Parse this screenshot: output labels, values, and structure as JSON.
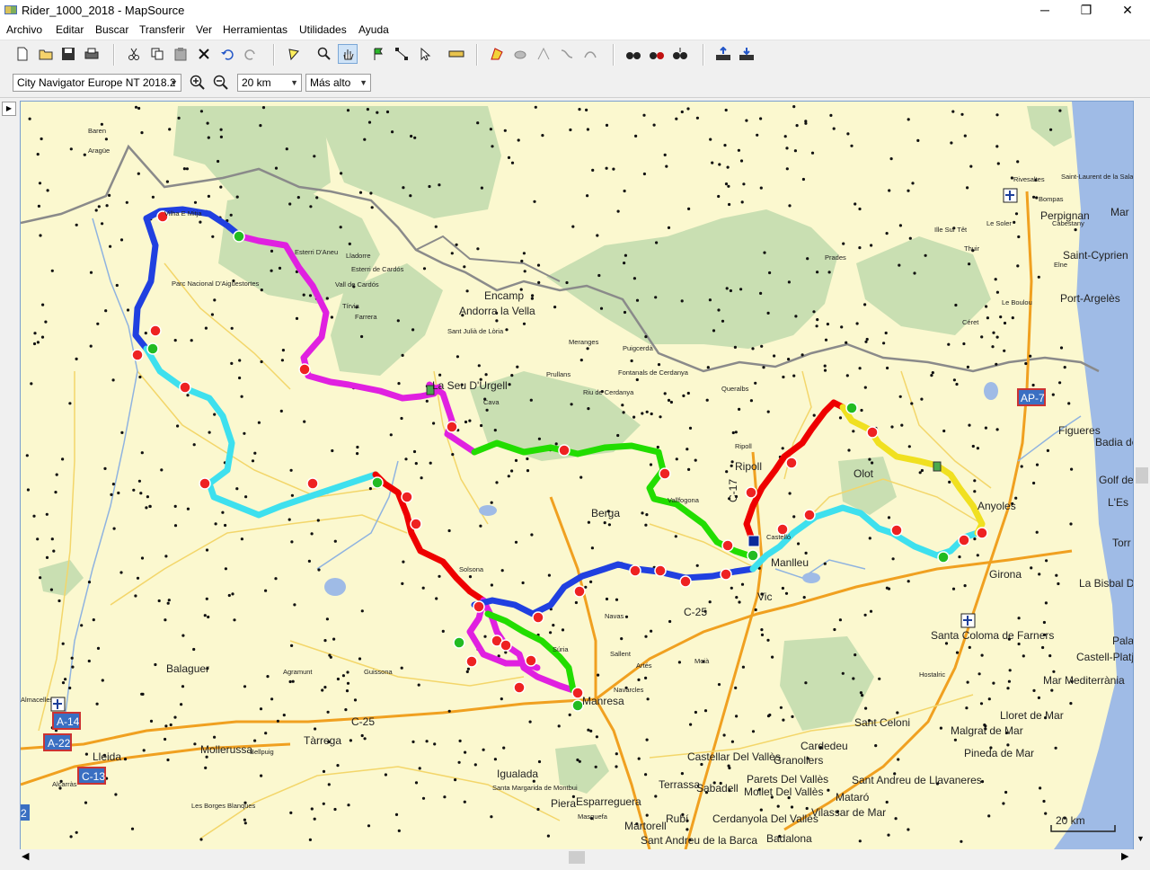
{
  "window": {
    "title": "Rider_1000_2018 - MapSource",
    "minimize": "─",
    "maximize": "❐",
    "close": "✕"
  },
  "menu": [
    "Archivo",
    "Editar",
    "Buscar",
    "Transferir",
    "Ver",
    "Herramientas",
    "Utilidades",
    "Ayuda"
  ],
  "toolbar": {
    "icons": [
      "new-file-icon",
      "open-folder-icon",
      "save-icon",
      "print-icon",
      "cut-icon",
      "copy-icon",
      "paste-icon",
      "delete-icon",
      "undo-icon",
      "redo-icon",
      "select-icon",
      "zoom-tool-icon",
      "pan-hand-icon",
      "waypoint-flag-icon",
      "route-tool-icon",
      "pointer-icon",
      "measure-icon",
      "track-edit-icon",
      "eraser-icon",
      "track-join-icon",
      "track-divide-icon",
      "track-filter-icon",
      "find-binoculars-icon",
      "find-address-icon",
      "find-nearest-icon",
      "receive-from-device-icon",
      "send-to-device-icon"
    ]
  },
  "map_controls": {
    "map_product": "City Navigator Europe NT 2018.2",
    "zoom_level": "20 km",
    "detail_level": "Más alto",
    "zoom_in_icon": "zoom-in-icon",
    "zoom_out_icon": "zoom-out-icon"
  },
  "map": {
    "scale_label": "20 km",
    "places_large": [
      {
        "name": "Encamp"
      },
      {
        "name": "Andorra la Vella"
      },
      {
        "name": "La Seu D'Urgell"
      },
      {
        "name": "Perpignan"
      },
      {
        "name": "Saint-Cyprien"
      },
      {
        "name": "Port-Argelès"
      },
      {
        "name": "Berga"
      },
      {
        "name": "Ripoll"
      },
      {
        "name": "Olot"
      },
      {
        "name": "Manlleu"
      },
      {
        "name": "Vic"
      },
      {
        "name": "Girona"
      },
      {
        "name": "Figueres"
      },
      {
        "name": "Manresa"
      },
      {
        "name": "Balaguer"
      },
      {
        "name": "Tàrrega"
      },
      {
        "name": "Lleida"
      },
      {
        "name": "Igualada"
      },
      {
        "name": "Terrassa"
      },
      {
        "name": "Sabadell"
      },
      {
        "name": "Mataró"
      },
      {
        "name": "Granollers"
      },
      {
        "name": "Badalona"
      },
      {
        "name": "Rubí"
      },
      {
        "name": "Martorell"
      },
      {
        "name": "Cardedeu"
      },
      {
        "name": "Santa Coloma de Farners"
      },
      {
        "name": "Sant Celoni"
      },
      {
        "name": "Lloret de Mar"
      },
      {
        "name": "Malgrat de Mar"
      },
      {
        "name": "Pineda de Mar"
      },
      {
        "name": "Mar Mediterrània"
      },
      {
        "name": "Castell-Platja"
      },
      {
        "name": "La Bisbal D'E"
      },
      {
        "name": "Badia de"
      },
      {
        "name": "Golf de"
      },
      {
        "name": "L'Es"
      },
      {
        "name": "Torr"
      },
      {
        "name": "Pala"
      },
      {
        "name": "Mollerussa"
      },
      {
        "name": "Esparreguera"
      },
      {
        "name": "Piera"
      },
      {
        "name": "Castellar Del Vallès"
      },
      {
        "name": "Parets Del Vallès"
      },
      {
        "name": "Mollet Del Vallès"
      },
      {
        "name": "Sant Andreu de Llavaneres"
      },
      {
        "name": "Vilassar de Mar"
      },
      {
        "name": "Cerdanyola Del Vallès"
      },
      {
        "name": "Sant Andreu de la Barca"
      },
      {
        "name": "Mar"
      },
      {
        "name": "Anyoles"
      },
      {
        "name": "Vic"
      }
    ],
    "places_small": [
      "Baren",
      "Aragüe",
      "Vilha E Mitja",
      "Esterri D'Aneu",
      "Lladorre",
      "Esterri de Cardós",
      "Parc Nacional D'Aigüestortes",
      "Vall de Cardós",
      "Tírvia",
      "Farrera",
      "Sant Julià de Lòria",
      "Meranges",
      "Puigcerdà",
      "Prullans",
      "Fontanals de Cerdanya",
      "Riu de Cerdanya",
      "Queralbs",
      "Cava",
      "Rivesaltes",
      "Saint-Laurent de la Salanque",
      "Bompas",
      "Ille Sur Têt",
      "Le Soler",
      "Cabestany",
      "Thuir",
      "Elne",
      "Le Boulou",
      "Céret",
      "Prades",
      "Navas",
      "Súria",
      "Sallent",
      "Artés",
      "Navarcles",
      "Agramunt",
      "Guissona",
      "Bellpuig",
      "Alcarràs",
      "Les Borges Blanques",
      "Santa Margarida de Montbui",
      "Masquefa",
      "Almacelles",
      "Solsona",
      "Ripoll",
      "Vallfogona",
      "Moià",
      "Castelló",
      "Hostalric"
    ],
    "road_shields": [
      {
        "label": "AP-7",
        "color": "#3a6fc2"
      },
      {
        "label": "A-14",
        "color": "#3a6fc2"
      },
      {
        "label": "A-22",
        "color": "#3a6fc2"
      },
      {
        "label": "C-13",
        "color": "#3a6fc2"
      },
      {
        "label": "2",
        "color": "#3a6fc2"
      }
    ],
    "road_labels": [
      "C-25",
      "C-25",
      "C-17"
    ],
    "track_colors": {
      "magenta": "#e020e0",
      "cyan": "#3ee0ee",
      "green": "#22dd00",
      "red": "#ee0000",
      "blue": "#2040e0",
      "yellow": "#f0e020"
    }
  }
}
